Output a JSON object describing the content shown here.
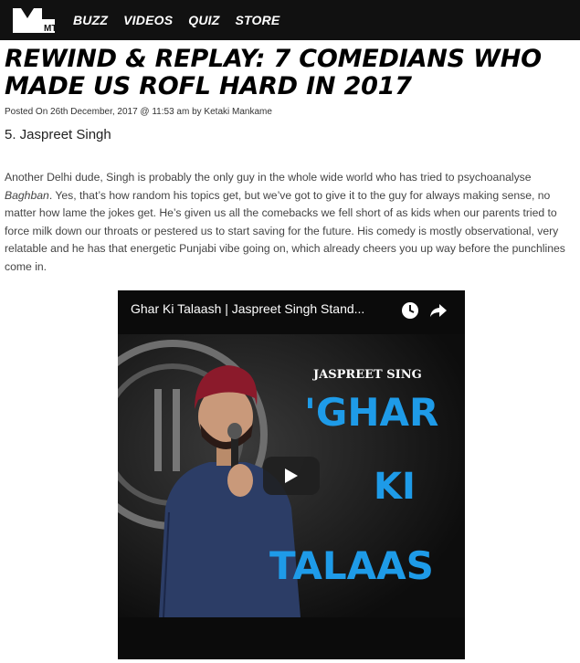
{
  "brand": {
    "logo_text": "MTV"
  },
  "nav": {
    "items": [
      "BUZZ",
      "VIDEOS",
      "QUIZ",
      "STORE"
    ]
  },
  "article": {
    "title_line1": "REWIND & REPLAY: 7 COMEDIANS WHO",
    "title_line2": "MADE US ROFL HARD IN 2017",
    "meta": "Posted On 26th December, 2017 @ 11:53 am by Ketaki Mankame",
    "subheading": "5. Jaspreet Singh",
    "para_before": "Another Delhi dude, Singh is probably the only guy in the whole wide world who has tried to psychoanalyse ",
    "para_italic": "Baghban",
    "para_after": ". Yes, that’s how random his topics get, but we’ve got to give it to the guy for always making sense, no matter how lame the jokes get. He’s given us all the comebacks we fell short of as kids when our parents tried to force milk down our throats or pestered us to start saving for the future. His comedy is mostly observational, very relatable and he has that energetic Punjabi vibe going on, which already cheers you up way before the punchlines come in."
  },
  "video": {
    "title": "Ghar Ki Talaash | Jaspreet Singh Stand...",
    "thumb_name": "JASPREET SING",
    "thumb_line1": "'GHAR",
    "thumb_line2": "KI",
    "thumb_line3": "TALAAS"
  },
  "colors": {
    "topbar": "#111111",
    "accent_blue": "#1e9be8",
    "turban": "#8b1a2b"
  },
  "icons": [
    "mtv-logo",
    "clock-icon",
    "share-icon",
    "play-icon"
  ]
}
